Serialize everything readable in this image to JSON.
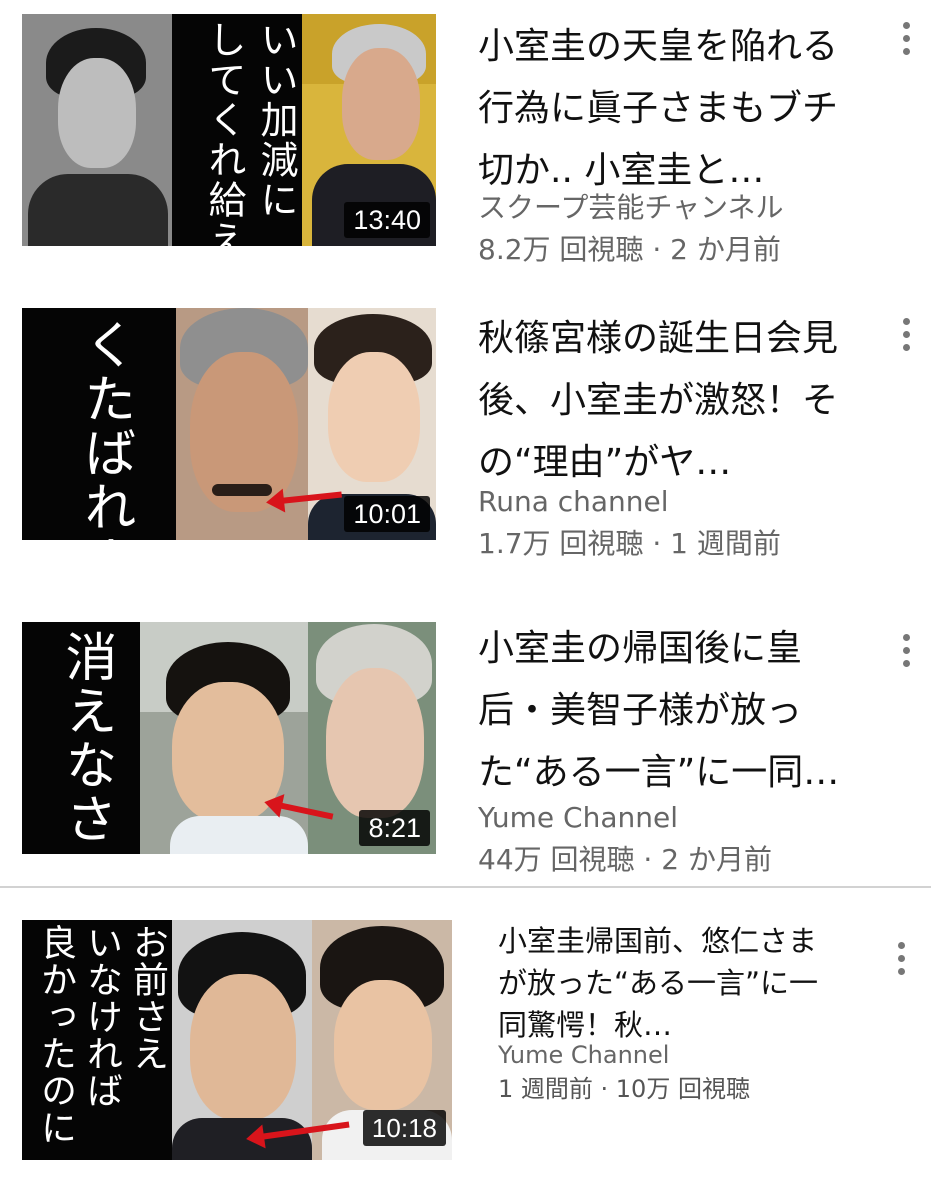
{
  "videos": [
    {
      "title": "小室圭の天皇を陥れる行為に眞子さまもブチ切か.. 小室圭と…",
      "channel": "スクープ芸能チャンネル",
      "stats": "8.2万 回視聴 · 2 か月前",
      "duration": "13:40",
      "overlay_text": "いい加減に\nしてくれ給え",
      "more_icon": "vertical-ellipsis-icon"
    },
    {
      "title": "秋篠宮様の誕生日会見後、小室圭が激怒！その“理由”がヤ…",
      "channel": "Runa channel",
      "stats": "1.7万 回視聴 · 1 週間前",
      "duration": "10:01",
      "overlay_text": "くたばれよ",
      "more_icon": "vertical-ellipsis-icon"
    },
    {
      "title": "小室圭の帰国後に皇后・美智子様が放った“ある一言”に一同…",
      "channel": "Yume Channel",
      "stats": "44万 回視聴 · 2 か月前",
      "duration": "8:21",
      "overlay_text": "消えなさい",
      "more_icon": "vertical-ellipsis-icon"
    },
    {
      "title": "小室圭帰国前、悠仁さまが放った“ある一言”に一同驚愕！秋…",
      "channel": "Yume Channel",
      "stats": "1 週間前 · 10万 回視聴",
      "duration": "10:18",
      "overlay_text": "お前さえ\nいなければ\n良かったのに",
      "more_icon": "vertical-ellipsis-icon"
    }
  ],
  "colors": {
    "arrow": "#d8141b",
    "meta_text": "#666666",
    "title_text": "#111111",
    "duration_bg": "#000000"
  }
}
